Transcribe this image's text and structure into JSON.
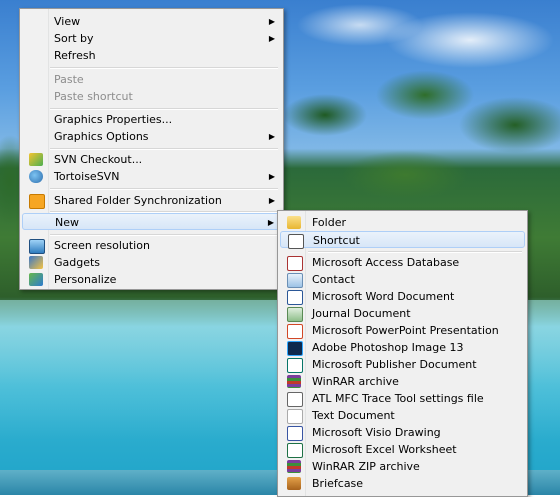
{
  "context_menu": {
    "items": [
      {
        "label": "View",
        "submenu": true
      },
      {
        "label": "Sort by",
        "submenu": true
      },
      {
        "label": "Refresh"
      },
      {
        "label": "Paste",
        "disabled": true
      },
      {
        "label": "Paste shortcut",
        "disabled": true
      },
      {
        "label": "Graphics Properties..."
      },
      {
        "label": "Graphics Options",
        "submenu": true
      },
      {
        "label": "SVN Checkout..."
      },
      {
        "label": "TortoiseSVN",
        "submenu": true
      },
      {
        "label": "Shared Folder Synchronization",
        "submenu": true
      },
      {
        "label": "New",
        "submenu": true,
        "highlighted": true
      },
      {
        "label": "Screen resolution"
      },
      {
        "label": "Gadgets"
      },
      {
        "label": "Personalize"
      }
    ]
  },
  "new_submenu": {
    "items": [
      {
        "label": "Folder",
        "icon": "folder-icon"
      },
      {
        "label": "Shortcut",
        "icon": "shortcut-icon",
        "highlighted": true
      },
      {
        "label": "Microsoft Access Database",
        "icon": "access-icon"
      },
      {
        "label": "Contact",
        "icon": "contact-icon"
      },
      {
        "label": "Microsoft Word Document",
        "icon": "word-icon"
      },
      {
        "label": "Journal Document",
        "icon": "journal-icon"
      },
      {
        "label": "Microsoft PowerPoint Presentation",
        "icon": "powerpoint-icon"
      },
      {
        "label": "Adobe Photoshop Image 13",
        "icon": "photoshop-icon"
      },
      {
        "label": "Microsoft Publisher Document",
        "icon": "publisher-icon"
      },
      {
        "label": "WinRAR archive",
        "icon": "winrar-icon"
      },
      {
        "label": "ATL MFC Trace Tool settings file",
        "icon": "atl-trace-icon"
      },
      {
        "label": "Text Document",
        "icon": "text-document-icon"
      },
      {
        "label": "Microsoft Visio Drawing",
        "icon": "visio-icon"
      },
      {
        "label": "Microsoft Excel Worksheet",
        "icon": "excel-icon"
      },
      {
        "label": "WinRAR ZIP archive",
        "icon": "winrar-zip-icon"
      },
      {
        "label": "Briefcase",
        "icon": "briefcase-icon"
      }
    ]
  },
  "colors": {
    "menu_background": "#f0f0f0",
    "highlight": "#d7e6f7",
    "disabled_text": "#8d8d8d"
  }
}
